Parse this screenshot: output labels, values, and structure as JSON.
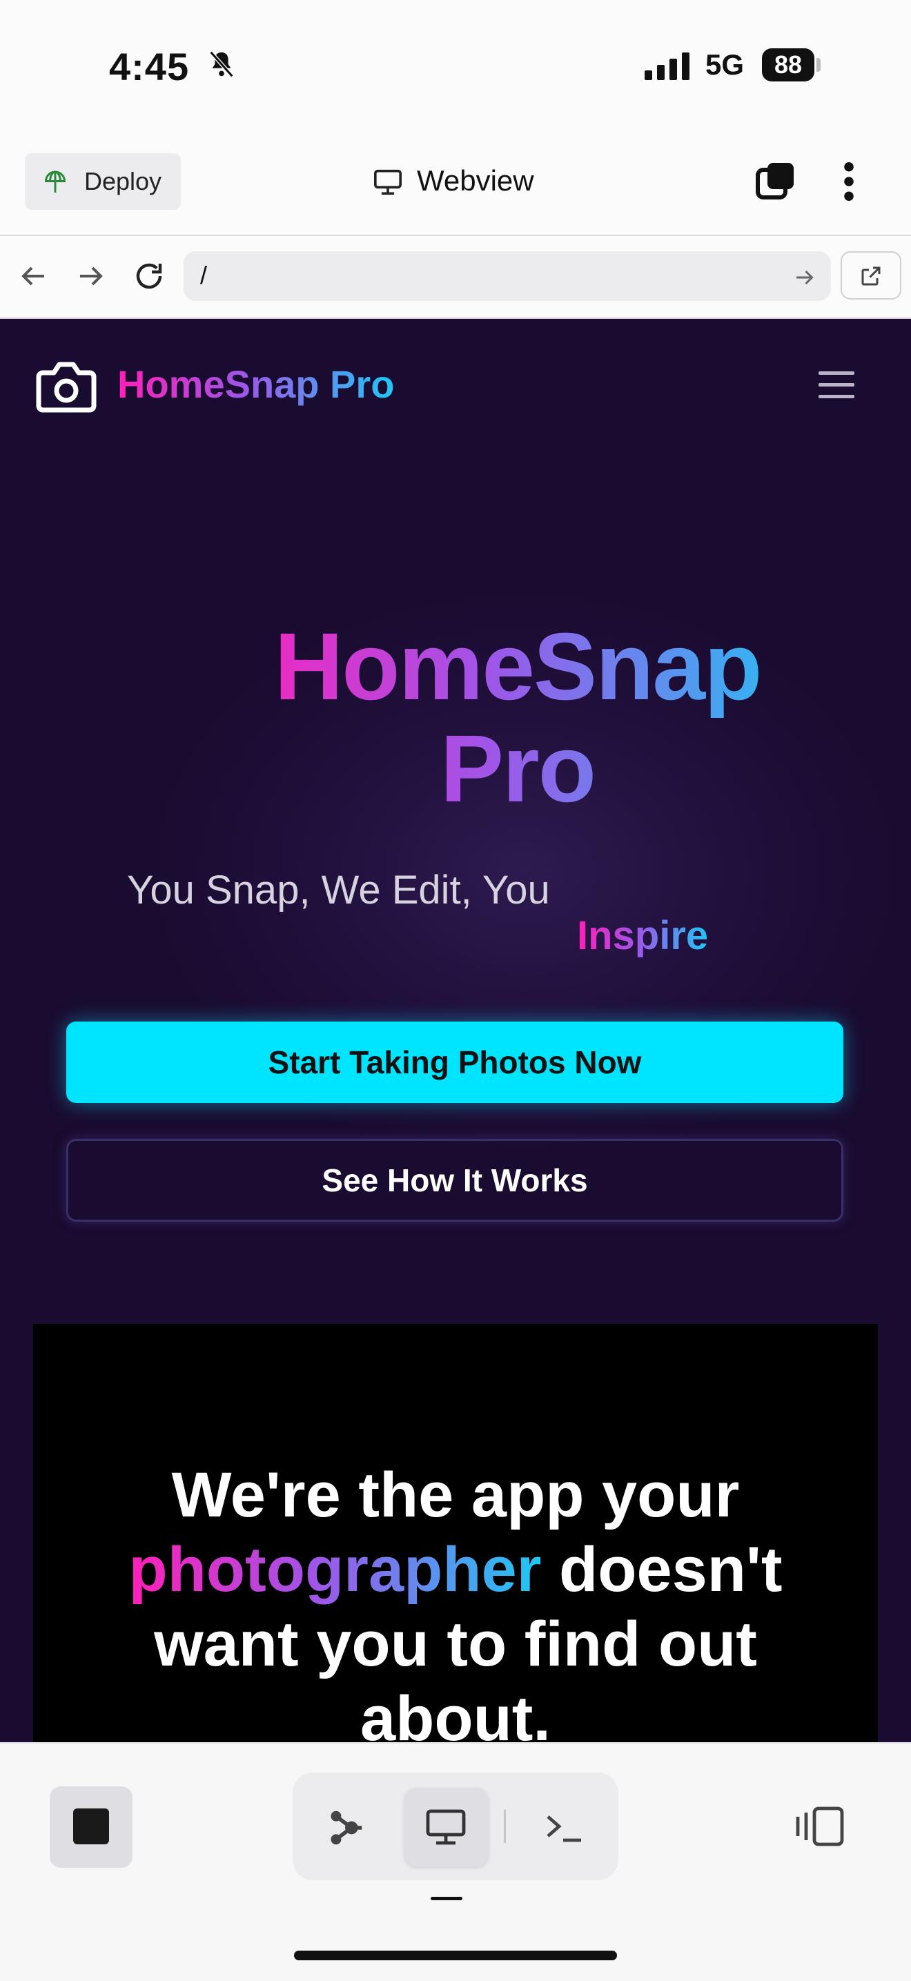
{
  "status_bar": {
    "time": "4:45",
    "network": "5G",
    "battery": "88"
  },
  "app_header": {
    "deploy_label": "Deploy",
    "webview_label": "Webview"
  },
  "url_bar": {
    "value": "/"
  },
  "site": {
    "brand": "HomeSnap Pro",
    "hero_title_line1": "HomeSnap",
    "hero_title_line2": "Pro",
    "subtitle": "You Snap, We Edit, You",
    "subtitle_accent": "Inspire",
    "primary_cta": "Start Taking Photos Now",
    "secondary_cta": "See How It Works",
    "tagline_part1": "We're the app your",
    "tagline_accent": "photographer",
    "tagline_part2": "doesn't want you to find out about."
  },
  "colors": {
    "accent_cyan": "#00e5ff",
    "gradient_pink": "#ff1fb8",
    "gradient_purple": "#a055e8",
    "gradient_blue": "#1ec8f4",
    "page_bg": "#1f0f3a"
  }
}
